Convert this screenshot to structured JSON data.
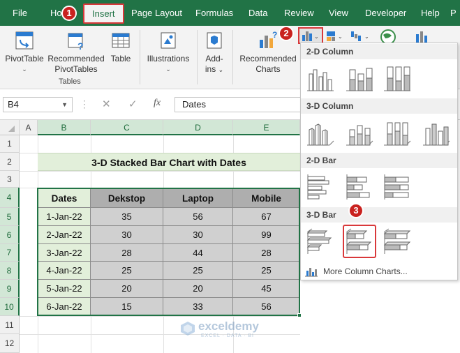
{
  "menubar": {
    "items": [
      "File",
      "Ho",
      "Insert",
      "Page Layout",
      "Formulas",
      "Data",
      "Review",
      "View",
      "Developer",
      "Help",
      "P"
    ],
    "active": "Insert",
    "steps": [
      "1",
      "2",
      "3"
    ]
  },
  "ribbon": {
    "pivottable": "PivotTable",
    "recommended_pivot_1": "Recommended",
    "recommended_pivot_2": "PivotTables",
    "table": "Table",
    "group_tables": "Tables",
    "illustrations": "Illustrations",
    "addins_1": "Add-",
    "addins_2": "ins",
    "recommended_charts_1": "Recommended",
    "recommended_charts_2": "Charts"
  },
  "formula_bar": {
    "name_box": "B4",
    "fx": "fx",
    "value": "Dates"
  },
  "grid": {
    "columns": [
      "A",
      "B",
      "C",
      "D",
      "E"
    ],
    "rows": [
      "1",
      "2",
      "3",
      "4",
      "5",
      "6",
      "7",
      "8",
      "9",
      "10",
      "11",
      "12"
    ],
    "title": "3-D Stacked Bar Chart with Dates",
    "table": {
      "headers": [
        "Dates",
        "Dekstop",
        "Laptop",
        "Mobile"
      ],
      "rows": [
        [
          "1-Jan-22",
          "35",
          "56",
          "67"
        ],
        [
          "2-Jan-22",
          "30",
          "30",
          "99"
        ],
        [
          "3-Jan-22",
          "28",
          "44",
          "28"
        ],
        [
          "4-Jan-22",
          "25",
          "25",
          "25"
        ],
        [
          "5-Jan-22",
          "20",
          "20",
          "45"
        ],
        [
          "6-Jan-22",
          "15",
          "33",
          "56"
        ]
      ]
    }
  },
  "dropdown": {
    "sections": [
      "2-D Column",
      "3-D Column",
      "2-D Bar",
      "3-D Bar"
    ],
    "more": "More Column Charts..."
  },
  "watermark": {
    "name": "exceldemy",
    "tagline": "EXCEL · DATA · BI"
  },
  "colors": {
    "excel_green": "#217346",
    "highlight_red": "#d9383a",
    "title_fill": "#e2efda",
    "header_fill": "#aeaeae",
    "value_fill": "#d0d0d0"
  }
}
